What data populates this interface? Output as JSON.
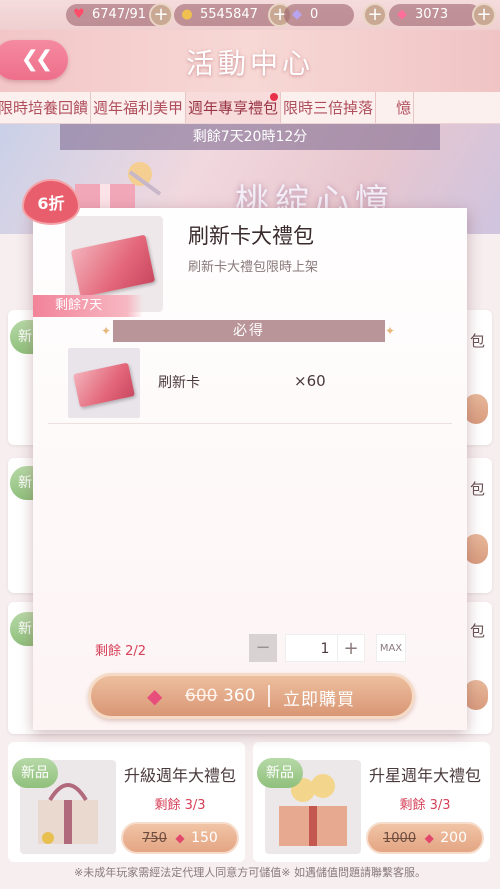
{
  "topbar": {
    "stamina": "6747/91",
    "gold": "5545847",
    "crystal": "0",
    "diamond": "3073"
  },
  "header": {
    "title": "活動中心",
    "back_icon": "double-chevron-left-icon"
  },
  "tabs": [
    {
      "label": "限時培養回饋"
    },
    {
      "label": "週年福利美甲"
    },
    {
      "label": "週年專享禮包"
    },
    {
      "label": "限時三倍掉落"
    },
    {
      "label": "憶"
    }
  ],
  "banner": {
    "timer": "剩餘7天20時12分",
    "title": "桃綻心憶"
  },
  "popup": {
    "discount": "6折",
    "title": "刷新卡大禮包",
    "subtitle": "刷新卡大禮包限時上架",
    "remain_tag": "剩餘7天",
    "must_label": "必得",
    "item": {
      "name": "刷新卡",
      "qty": "×60"
    },
    "stock": "剩餘 2/2",
    "stepper": {
      "minus": "−",
      "value": "1",
      "plus": "+",
      "max": "MAX"
    },
    "buy": {
      "old_price": "600",
      "new_price": "360",
      "label": "立即購買"
    }
  },
  "side": {
    "badge": "新品",
    "bag_char": "包"
  },
  "bottom_cards": [
    {
      "badge": "新品",
      "name": "升級週年大禮包",
      "remain": "剩餘 3/3",
      "old_price": "750",
      "price": "150"
    },
    {
      "badge": "新品",
      "name": "升星週年大禮包",
      "remain": "剩餘 3/3",
      "old_price": "1000",
      "price": "200"
    }
  ],
  "footer_note": "※未成年玩家需經法定代理人同意方可儲值※ 如遇儲值問題請聯繫客服。"
}
